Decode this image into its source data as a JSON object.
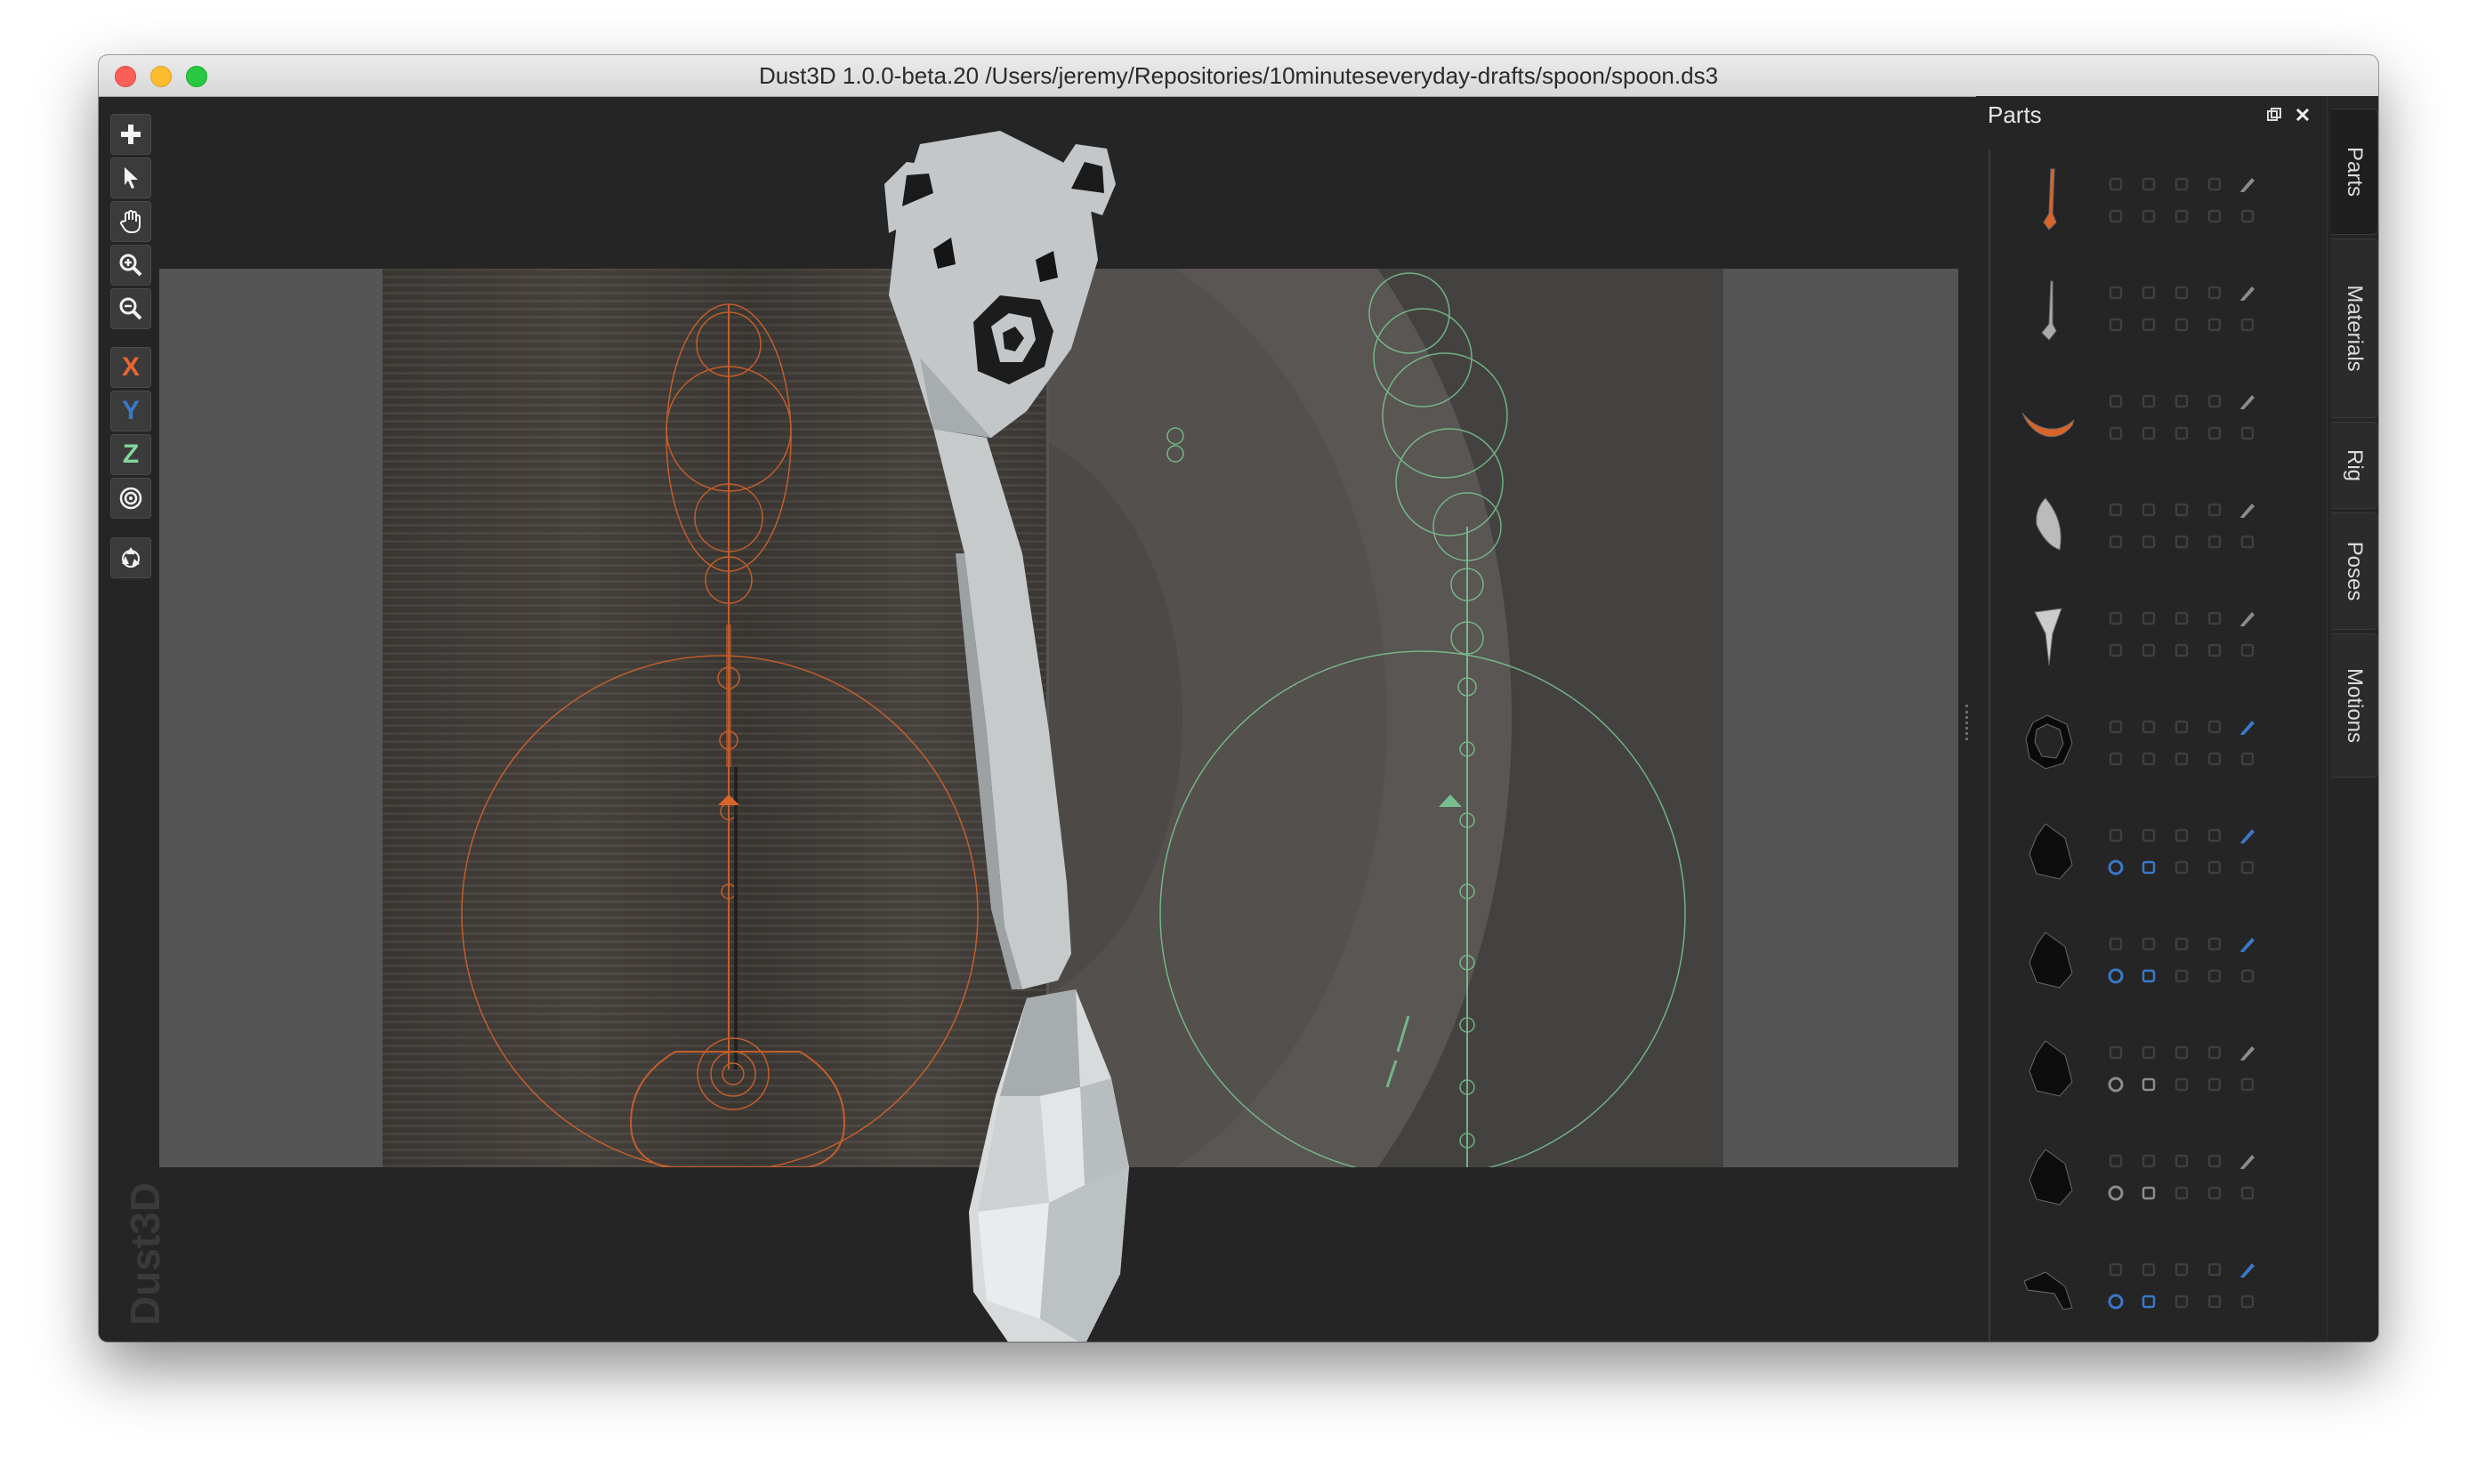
{
  "window": {
    "title": "Dust3D 1.0.0-beta.20 /Users/jeremy/Repositories/10minuteseveryday-drafts/spoon/spoon.ds3"
  },
  "toolbar": {
    "tools": [
      {
        "name": "add-icon"
      },
      {
        "name": "select-icon"
      },
      {
        "name": "pan-hand-icon"
      },
      {
        "name": "zoom-in-icon"
      },
      {
        "name": "zoom-out-icon"
      }
    ],
    "axes": [
      {
        "label": "X",
        "color": "#e8662f"
      },
      {
        "label": "Y",
        "color": "#3a78c8"
      },
      {
        "label": "Z",
        "color": "#7fd79c"
      }
    ],
    "radial_icon": "radial-mirror-icon",
    "recycle_icon": "recycle-icon"
  },
  "watermark": "Dust3D",
  "parts_panel": {
    "title": "Parts",
    "float_icon": "float-panel-icon",
    "close_icon": "close-panel-icon",
    "parts": [
      {
        "shape": "handle",
        "color": "#d9642a",
        "active": false
      },
      {
        "shape": "stick",
        "color": "#aaaaaa",
        "active": false
      },
      {
        "shape": "curve",
        "color": "#d9642a",
        "active": false
      },
      {
        "shape": "leaf",
        "color": "#bbbbbb",
        "active": false
      },
      {
        "shape": "taper",
        "color": "#cccccc",
        "active": false
      },
      {
        "shape": "ring",
        "color": "#0a0a0a",
        "active": false
      },
      {
        "shape": "rock",
        "color": "#0d0d0d",
        "active": true
      },
      {
        "shape": "rock",
        "color": "#0d0d0d",
        "active": true
      },
      {
        "shape": "rock",
        "color": "#0d0d0d",
        "active": false
      },
      {
        "shape": "rock",
        "color": "#0d0d0d",
        "active": false
      },
      {
        "shape": "arm",
        "color": "#0d0d0d",
        "active": true
      },
      {
        "shape": "flat",
        "color": "#0d0d0d",
        "active": false
      }
    ]
  },
  "side_tabs": [
    "Parts",
    "Materials",
    "Rig",
    "Poses",
    "Motions"
  ],
  "colors": {
    "accent": "#3a78c8",
    "orange": "#d9642a",
    "green": "#7fd79c",
    "background": "#252525"
  }
}
